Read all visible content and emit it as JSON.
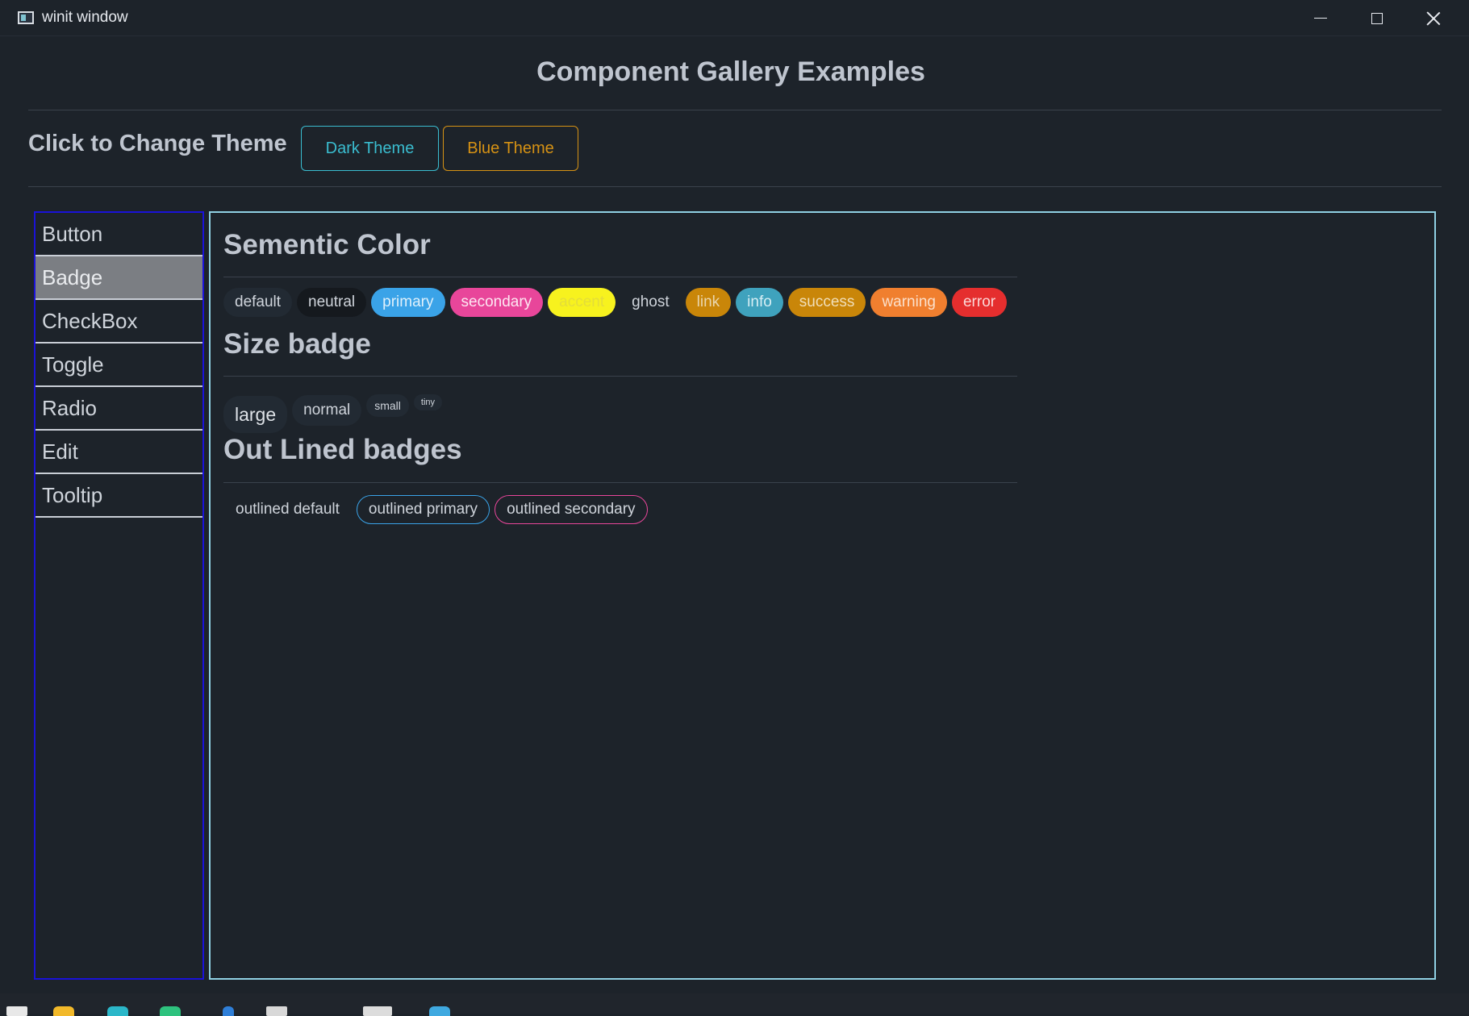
{
  "window": {
    "title": "winit window",
    "controls": {
      "minimize": "minimize",
      "maximize": "maximize",
      "close": "close"
    }
  },
  "header": {
    "title": "Component Gallery Examples",
    "theme_label": "Click to Change Theme",
    "theme_buttons": [
      {
        "label": "Dark Theme",
        "color": "#3abdd0"
      },
      {
        "label": "Blue Theme",
        "color": "#d69214"
      }
    ]
  },
  "sidebar": {
    "items": [
      {
        "label": "Button",
        "active": false
      },
      {
        "label": "Badge",
        "active": true
      },
      {
        "label": "CheckBox",
        "active": false
      },
      {
        "label": "Toggle",
        "active": false
      },
      {
        "label": "Radio",
        "active": false
      },
      {
        "label": "Edit",
        "active": false
      },
      {
        "label": "Tooltip",
        "active": false
      }
    ]
  },
  "content": {
    "semantic": {
      "title": "Sementic Color",
      "badges": [
        "default",
        "neutral",
        "primary",
        "secondary",
        "accent",
        "ghost",
        "link",
        "info",
        "success",
        "warning",
        "error"
      ]
    },
    "size": {
      "title": "Size badge",
      "badges": [
        "large",
        "normal",
        "small",
        "tiny"
      ]
    },
    "outlined": {
      "title": "Out Lined badges",
      "badges": [
        "outlined default",
        "outlined primary",
        "outlined secondary"
      ]
    }
  },
  "colors": {
    "background": "#1d232a",
    "sidebar_border": "#1a12d8",
    "content_border": "#8fd0e3",
    "primary": "#3aa3e8",
    "secondary": "#e8469a",
    "accent": "#f7f21e",
    "info": "#3fa2bd",
    "success": "#c98609",
    "warning": "#f07f2f",
    "error": "#e52e2e"
  }
}
